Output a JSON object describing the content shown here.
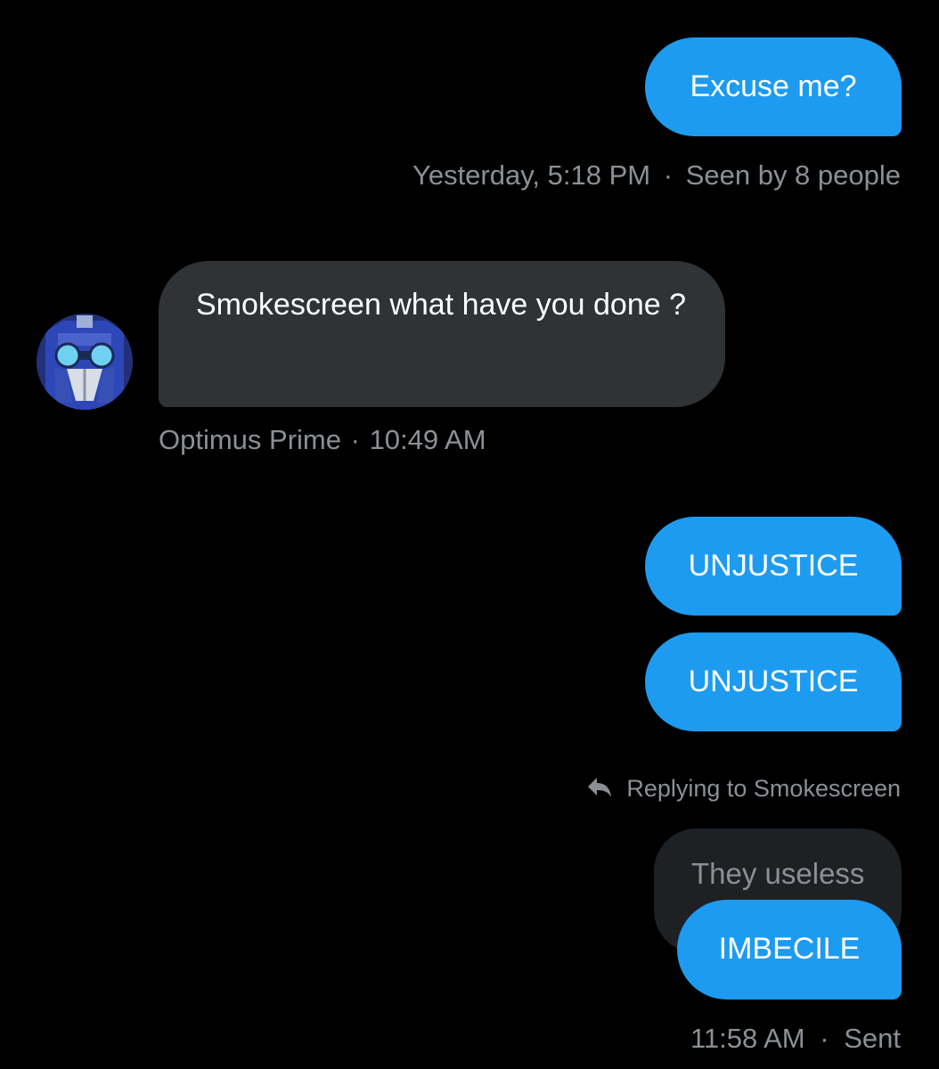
{
  "messages": {
    "m1": {
      "text": "Excuse me?"
    },
    "m1_meta": {
      "time": "Yesterday, 5:18 PM",
      "sep": "·",
      "status": "Seen by 8 people"
    },
    "m2": {
      "text": "Smokescreen what have you done ?"
    },
    "m2_meta": {
      "sender": "Optimus Prime",
      "sep": "·",
      "time": "10:49 AM"
    },
    "m3": {
      "text": "UNJUSTICE"
    },
    "m4": {
      "text": "UNJUSTICE"
    },
    "reply_context": {
      "text": "Replying to Smokescreen",
      "icon": "reply-arrow-icon"
    },
    "quoted": {
      "text": "They useless"
    },
    "m5": {
      "text": "IMBECILE"
    },
    "m5_meta": {
      "time": "11:58 AM",
      "sep": "·",
      "status": "Sent"
    }
  },
  "colors": {
    "background": "#000000",
    "sent_bubble": "#1d9bf0",
    "received_bubble": "#2f3336",
    "meta_text": "#8b9096"
  }
}
